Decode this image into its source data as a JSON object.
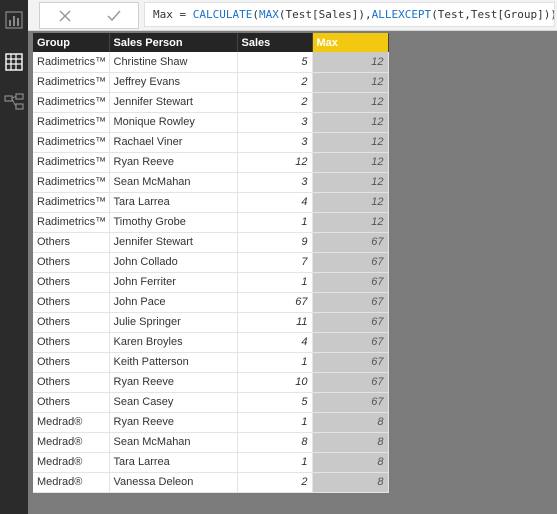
{
  "formula": {
    "prefix": "Max = ",
    "fn1": "CALCULATE",
    "p1": "(",
    "fn2": "MAX",
    "arg1": "(Test[Sales]),",
    "fn3": "ALLEXCEPT",
    "arg2": "(Test,Test[Group]))"
  },
  "icons": {
    "cancel": "close-icon",
    "commit": "check-icon",
    "report_view": "bar-chart-icon",
    "data_view": "table-grid-icon",
    "model_view": "relationships-icon"
  },
  "colors": {
    "selected_header": "#f2c811",
    "header": "#252525",
    "selected_column": "#c9c9c9"
  },
  "table": {
    "headers": [
      "Group",
      "Sales Person",
      "Sales",
      "Max"
    ],
    "rows": [
      [
        "Radimetrics™",
        "Christine Shaw",
        "5",
        "12"
      ],
      [
        "Radimetrics™",
        "Jeffrey Evans",
        "2",
        "12"
      ],
      [
        "Radimetrics™",
        "Jennifer Stewart",
        "2",
        "12"
      ],
      [
        "Radimetrics™",
        "Monique Rowley",
        "3",
        "12"
      ],
      [
        "Radimetrics™",
        "Rachael Viner",
        "3",
        "12"
      ],
      [
        "Radimetrics™",
        "Ryan Reeve",
        "12",
        "12"
      ],
      [
        "Radimetrics™",
        "Sean McMahan",
        "3",
        "12"
      ],
      [
        "Radimetrics™",
        "Tara Larrea",
        "4",
        "12"
      ],
      [
        "Radimetrics™",
        "Timothy Grobe",
        "1",
        "12"
      ],
      [
        "Others",
        "Jennifer Stewart",
        "9",
        "67"
      ],
      [
        "Others",
        "John Collado",
        "7",
        "67"
      ],
      [
        "Others",
        "John Ferriter",
        "1",
        "67"
      ],
      [
        "Others",
        "John Pace",
        "67",
        "67"
      ],
      [
        "Others",
        "Julie Springer",
        "11",
        "67"
      ],
      [
        "Others",
        "Karen Broyles",
        "4",
        "67"
      ],
      [
        "Others",
        "Keith Patterson",
        "1",
        "67"
      ],
      [
        "Others",
        "Ryan Reeve",
        "10",
        "67"
      ],
      [
        "Others",
        "Sean Casey",
        "5",
        "67"
      ],
      [
        "Medrad®",
        "Ryan Reeve",
        "1",
        "8"
      ],
      [
        "Medrad®",
        "Sean McMahan",
        "8",
        "8"
      ],
      [
        "Medrad®",
        "Tara Larrea",
        "1",
        "8"
      ],
      [
        "Medrad®",
        "Vanessa Deleon",
        "2",
        "8"
      ]
    ]
  }
}
